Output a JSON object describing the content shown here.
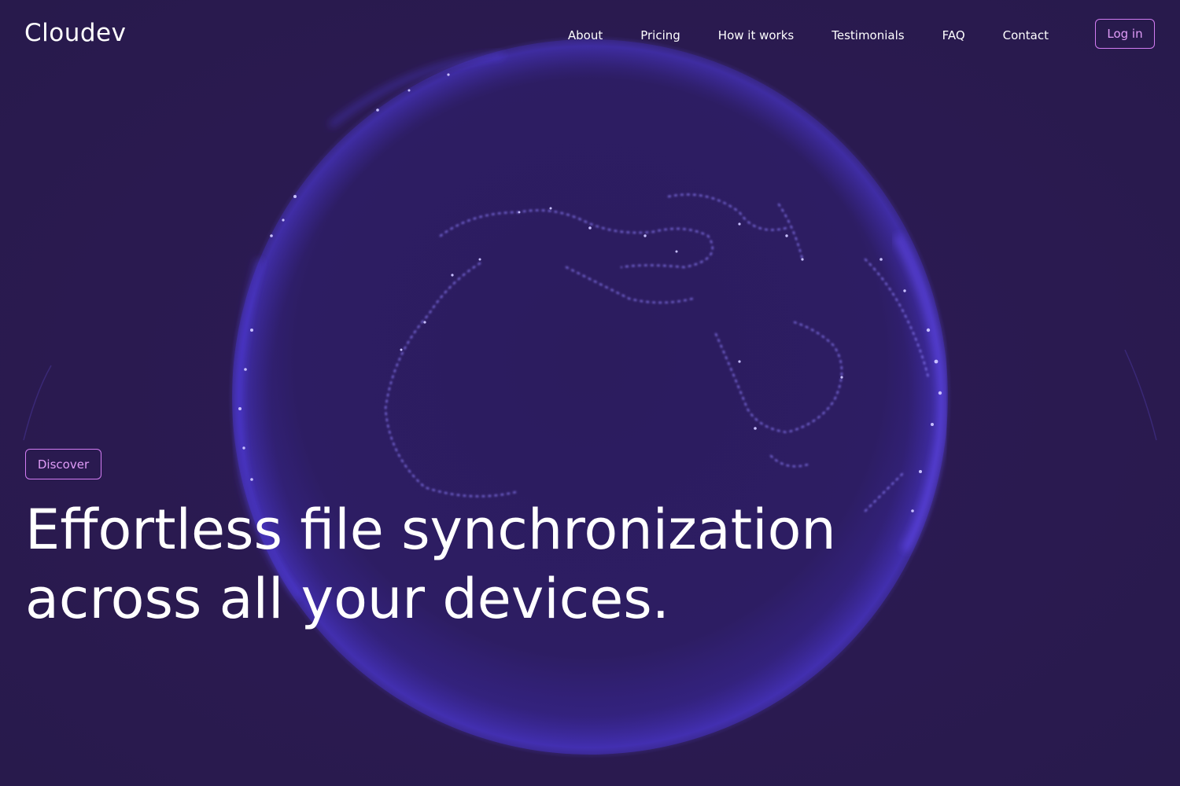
{
  "brand": {
    "name": "Cloudev"
  },
  "nav": {
    "items": [
      {
        "label": "About"
      },
      {
        "label": "Pricing"
      },
      {
        "label": "How it works"
      },
      {
        "label": "Testimonials"
      },
      {
        "label": "FAQ"
      },
      {
        "label": "Contact"
      }
    ],
    "login_label": "Log in"
  },
  "hero": {
    "cta_label": "Discover",
    "headline_line1": "Effortless file synchronization",
    "headline_line2": "across all your devices."
  },
  "colors": {
    "background": "#2b1a51",
    "accent": "#d27cf2",
    "globe_glow": "#5b3cff",
    "text": "#ffffff"
  },
  "icons": {
    "background": "globe-icon"
  }
}
